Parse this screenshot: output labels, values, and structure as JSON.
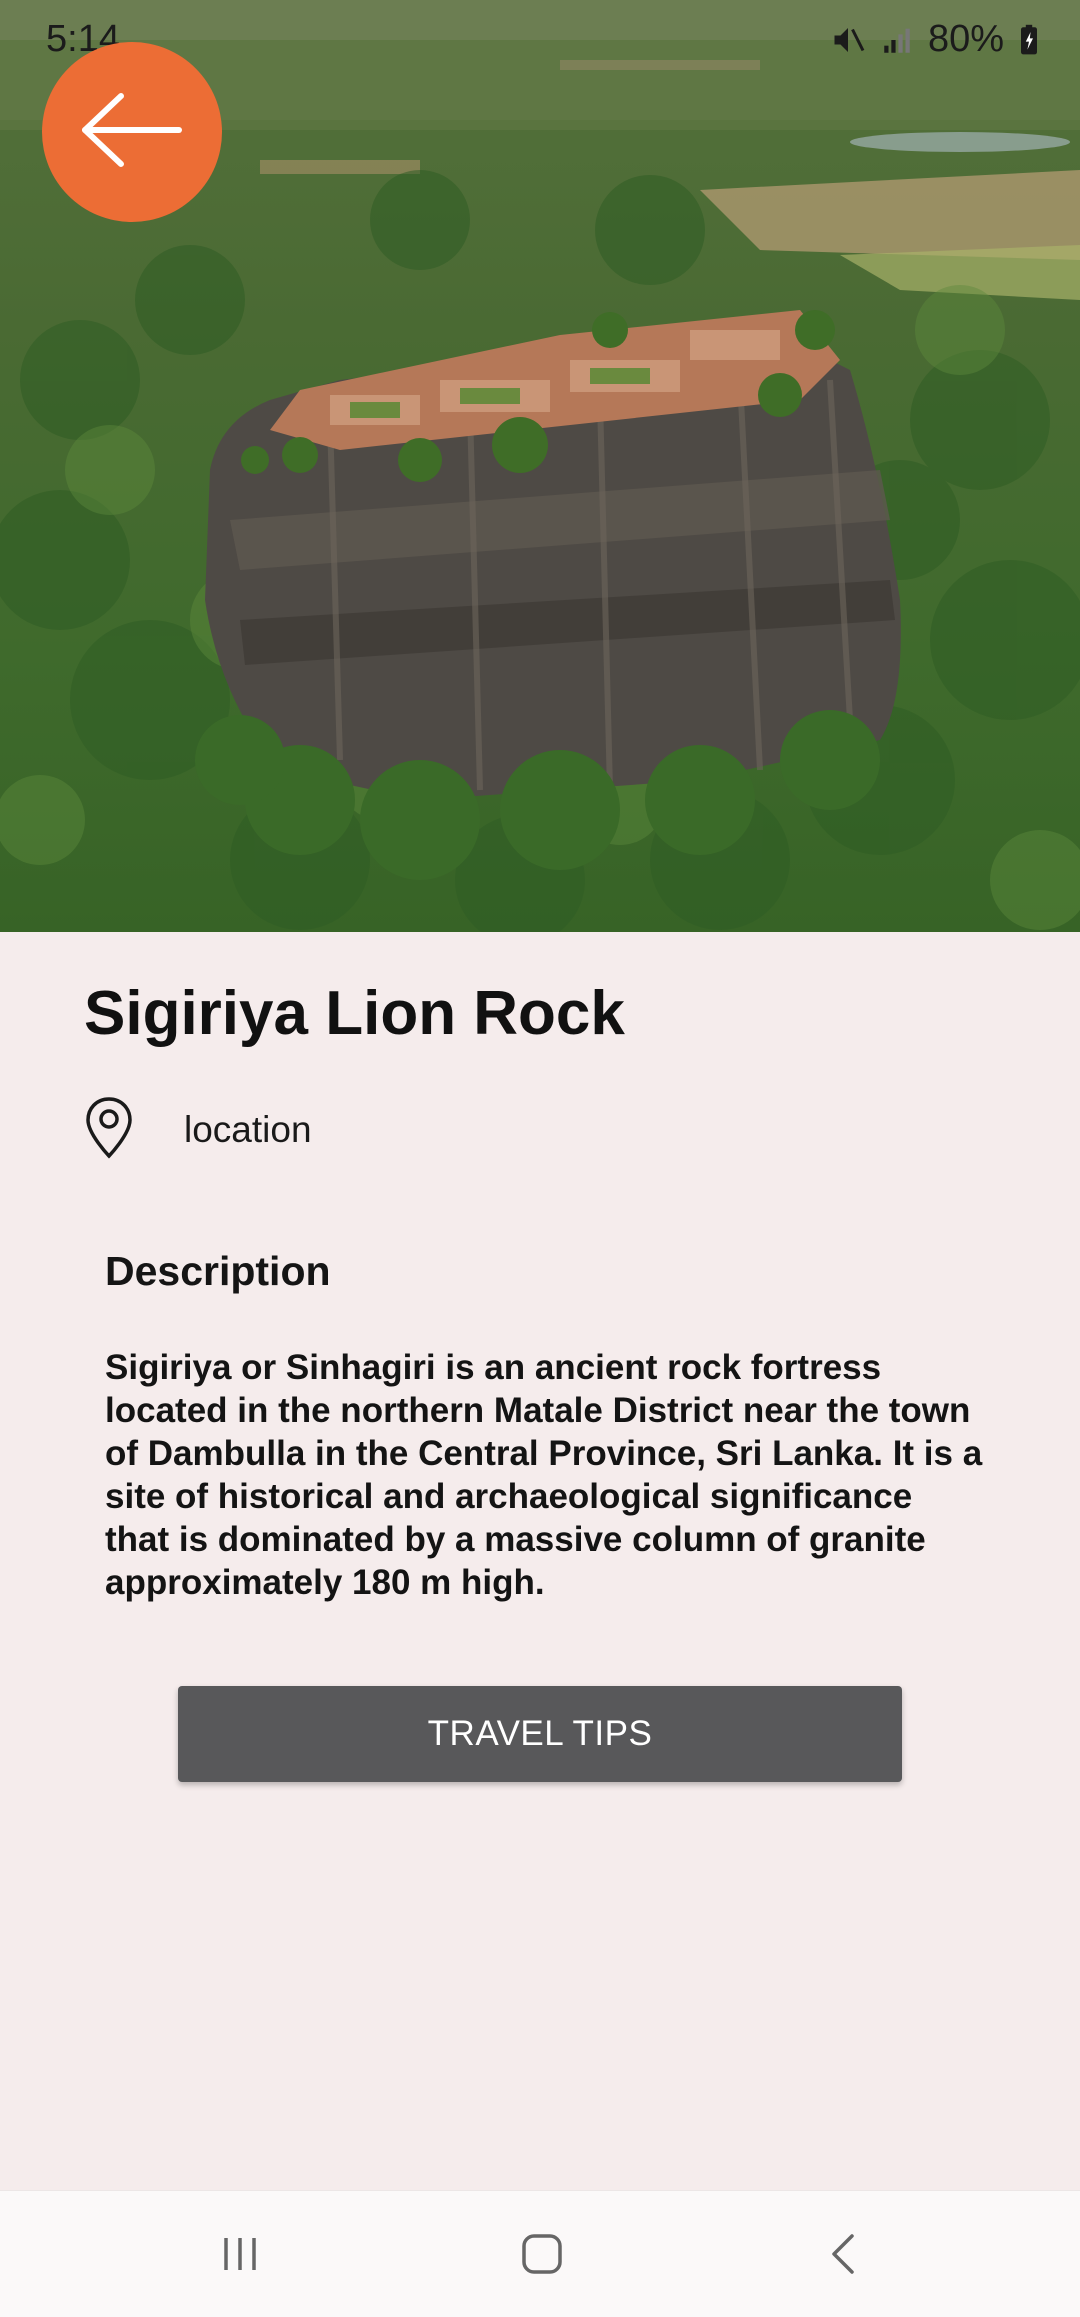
{
  "status_bar": {
    "time": "5:14",
    "battery": "80%",
    "icons": [
      "mute-icon",
      "signal-icon",
      "battery-icon"
    ]
  },
  "hero": {
    "image": "aerial-photo-sigiriya-rock"
  },
  "back_button": {
    "icon": "arrow-left-icon"
  },
  "place": {
    "title": "Sigiriya Lion Rock",
    "location_label": "location",
    "location_icon": "map-pin-icon"
  },
  "description": {
    "heading": "Description",
    "body": "Sigiriya or Sinhagiri is an ancient rock fortress located in the northern Matale District near the town of Dambulla in the Central Province, Sri Lanka. It is a site of historical and archaeological significance that is dominated by a massive column of granite approximately 180 m high."
  },
  "actions": {
    "travel_tips_label": "TRAVEL TIPS"
  },
  "nav": {
    "items": [
      "recents-icon",
      "home-icon",
      "back-icon"
    ]
  },
  "colors": {
    "accent": "#ec6d35",
    "background": "#f5ecec",
    "button": "#58585a"
  }
}
